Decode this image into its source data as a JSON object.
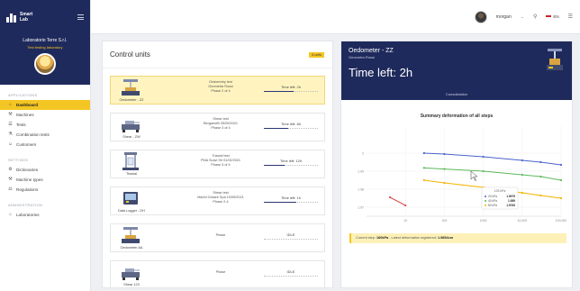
{
  "app": {
    "logo_text_1": "Smart",
    "logo_text_2": "Lab",
    "lab_name": "Laboratorio Terre S.r.l.",
    "lab_subtitle": "Test testing laboratory"
  },
  "sidebar": {
    "sections": [
      {
        "label": "APPLICATIONS",
        "items": [
          {
            "label": "Dashboard",
            "icon": "home-icon",
            "glyph": "⌂",
            "active": true
          },
          {
            "label": "Machines",
            "icon": "tool-icon",
            "glyph": "⚒",
            "active": false
          },
          {
            "label": "Tests",
            "icon": "list-icon",
            "glyph": "☰",
            "active": false
          },
          {
            "label": "Combination tests",
            "icon": "flask-icon",
            "glyph": "⚗",
            "active": false
          },
          {
            "label": "Customers",
            "icon": "users-icon",
            "glyph": "☺",
            "active": false
          }
        ]
      },
      {
        "label": "SETTINGS",
        "items": [
          {
            "label": "Dictionaries",
            "icon": "gear-icon",
            "glyph": "⚙",
            "active": false
          },
          {
            "label": "Machine types",
            "icon": "tool-icon",
            "glyph": "⚒",
            "active": false
          },
          {
            "label": "Regulations",
            "icon": "scale-icon",
            "glyph": "⚖",
            "active": false
          }
        ]
      },
      {
        "label": "ADMINISTRATION",
        "items": [
          {
            "label": "Laboratories",
            "icon": "building-icon",
            "glyph": "⌂",
            "active": false
          }
        ]
      }
    ]
  },
  "topbar": {
    "user_name": "morgan",
    "language": "EN",
    "search_icon": "search-icon",
    "menu_icon": "menu-icon"
  },
  "control_units": {
    "title": "Control units",
    "badge": "6 units",
    "units": [
      {
        "name": "Oedometer - ZZ",
        "info": [
          "Oedometry test",
          "Geometra Rossi",
          "Phase 2 of 4"
        ],
        "status": "Time left: 2h",
        "progress": 0.55,
        "selected": true,
        "icon": "oedometer-icon"
      },
      {
        "name": "Shear - ZW",
        "info": [
          "Shear test",
          "Bergamelli 05/05/2021",
          "Phase 3 of 4"
        ],
        "status": "Time left: 8h",
        "progress": 0.45,
        "selected": false,
        "icon": "shear-icon"
      },
      {
        "name": "Triaxial",
        "info": [
          "Triaxial test",
          "PMA Scavi Srl 01/02/2021",
          "Phase 3 of 4"
        ],
        "status": "Time left: 12h",
        "progress": 0.38,
        "selected": false,
        "icon": "triaxial-icon"
      },
      {
        "name": "Data Logger - DH",
        "info": [
          "Shear test",
          "Marini Cesare Spa 10/05/2021",
          "Phase 2-4"
        ],
        "status": "Time left: 1h",
        "progress": 0.6,
        "selected": false,
        "icon": "datalogger-icon"
      },
      {
        "name": "Oedometer AA",
        "info": [
          "Phase"
        ],
        "status": "IDLE",
        "progress": 0,
        "selected": false,
        "icon": "oedometer-icon"
      },
      {
        "name": "Shear 123",
        "info": [
          "Phase"
        ],
        "status": "IDLE",
        "progress": 0,
        "selected": false,
        "icon": "shear-icon"
      }
    ]
  },
  "detail": {
    "title": "Oedometer - ZZ",
    "subtitle": "Geometra Rossi",
    "time_left": "Time left: 2h",
    "phase": "Consolidation",
    "current_step_prefix": "Current step: ",
    "current_step_value": "160kPa",
    "current_step_mid": " - Latest deformation registered: ",
    "current_step_deformation": "1.9854cm"
  },
  "chart_data": {
    "type": "line",
    "title": "Summary deformation of all steps",
    "xlabel": "",
    "ylabel": "",
    "x_scale": "log",
    "xlim": [
      1,
      100000
    ],
    "ylim": [
      1.965,
      2.015
    ],
    "x_ticks": [
      "10",
      "100",
      "1000",
      "10,000",
      "100,000"
    ],
    "x_tick_values": [
      10,
      100,
      1000,
      10000,
      100000
    ],
    "y_ticks": [
      "1.97",
      "1.98",
      "1.99",
      "2"
    ],
    "y_tick_values": [
      1.97,
      1.98,
      1.99,
      2.0
    ],
    "series": [
      {
        "name": "20 kPa",
        "color": "#4a63c9",
        "x": [
          30,
          100,
          1000,
          10000,
          30000,
          100000
        ],
        "y": [
          2.0,
          1.9995,
          1.998,
          1.996,
          1.995,
          1.9935
        ]
      },
      {
        "name": "40 kPa",
        "color": "#5cb85c",
        "x": [
          30,
          100,
          1000,
          10000,
          30000,
          100000
        ],
        "y": [
          1.9918,
          1.9912,
          1.99,
          1.988,
          1.987,
          1.985
        ]
      },
      {
        "name": "80 kPa",
        "color": "#f4b400",
        "x": [
          30,
          100,
          1000,
          10000,
          30000,
          100000
        ],
        "y": [
          1.985,
          1.9835,
          1.981,
          1.978,
          1.9765,
          1.975
        ]
      },
      {
        "name": "160 kPa",
        "color": "#e14b4b",
        "x": [
          4,
          10
        ],
        "y": [
          1.9755,
          1.971
        ]
      }
    ],
    "tooltip": {
      "header": "125 kPa",
      "rows": [
        {
          "name": "20 kPa",
          "value": "1.9979"
        },
        {
          "name": "40 kPa",
          "value": "1.989"
        },
        {
          "name": "80 kPa",
          "value": "1.9783"
        }
      ]
    }
  }
}
